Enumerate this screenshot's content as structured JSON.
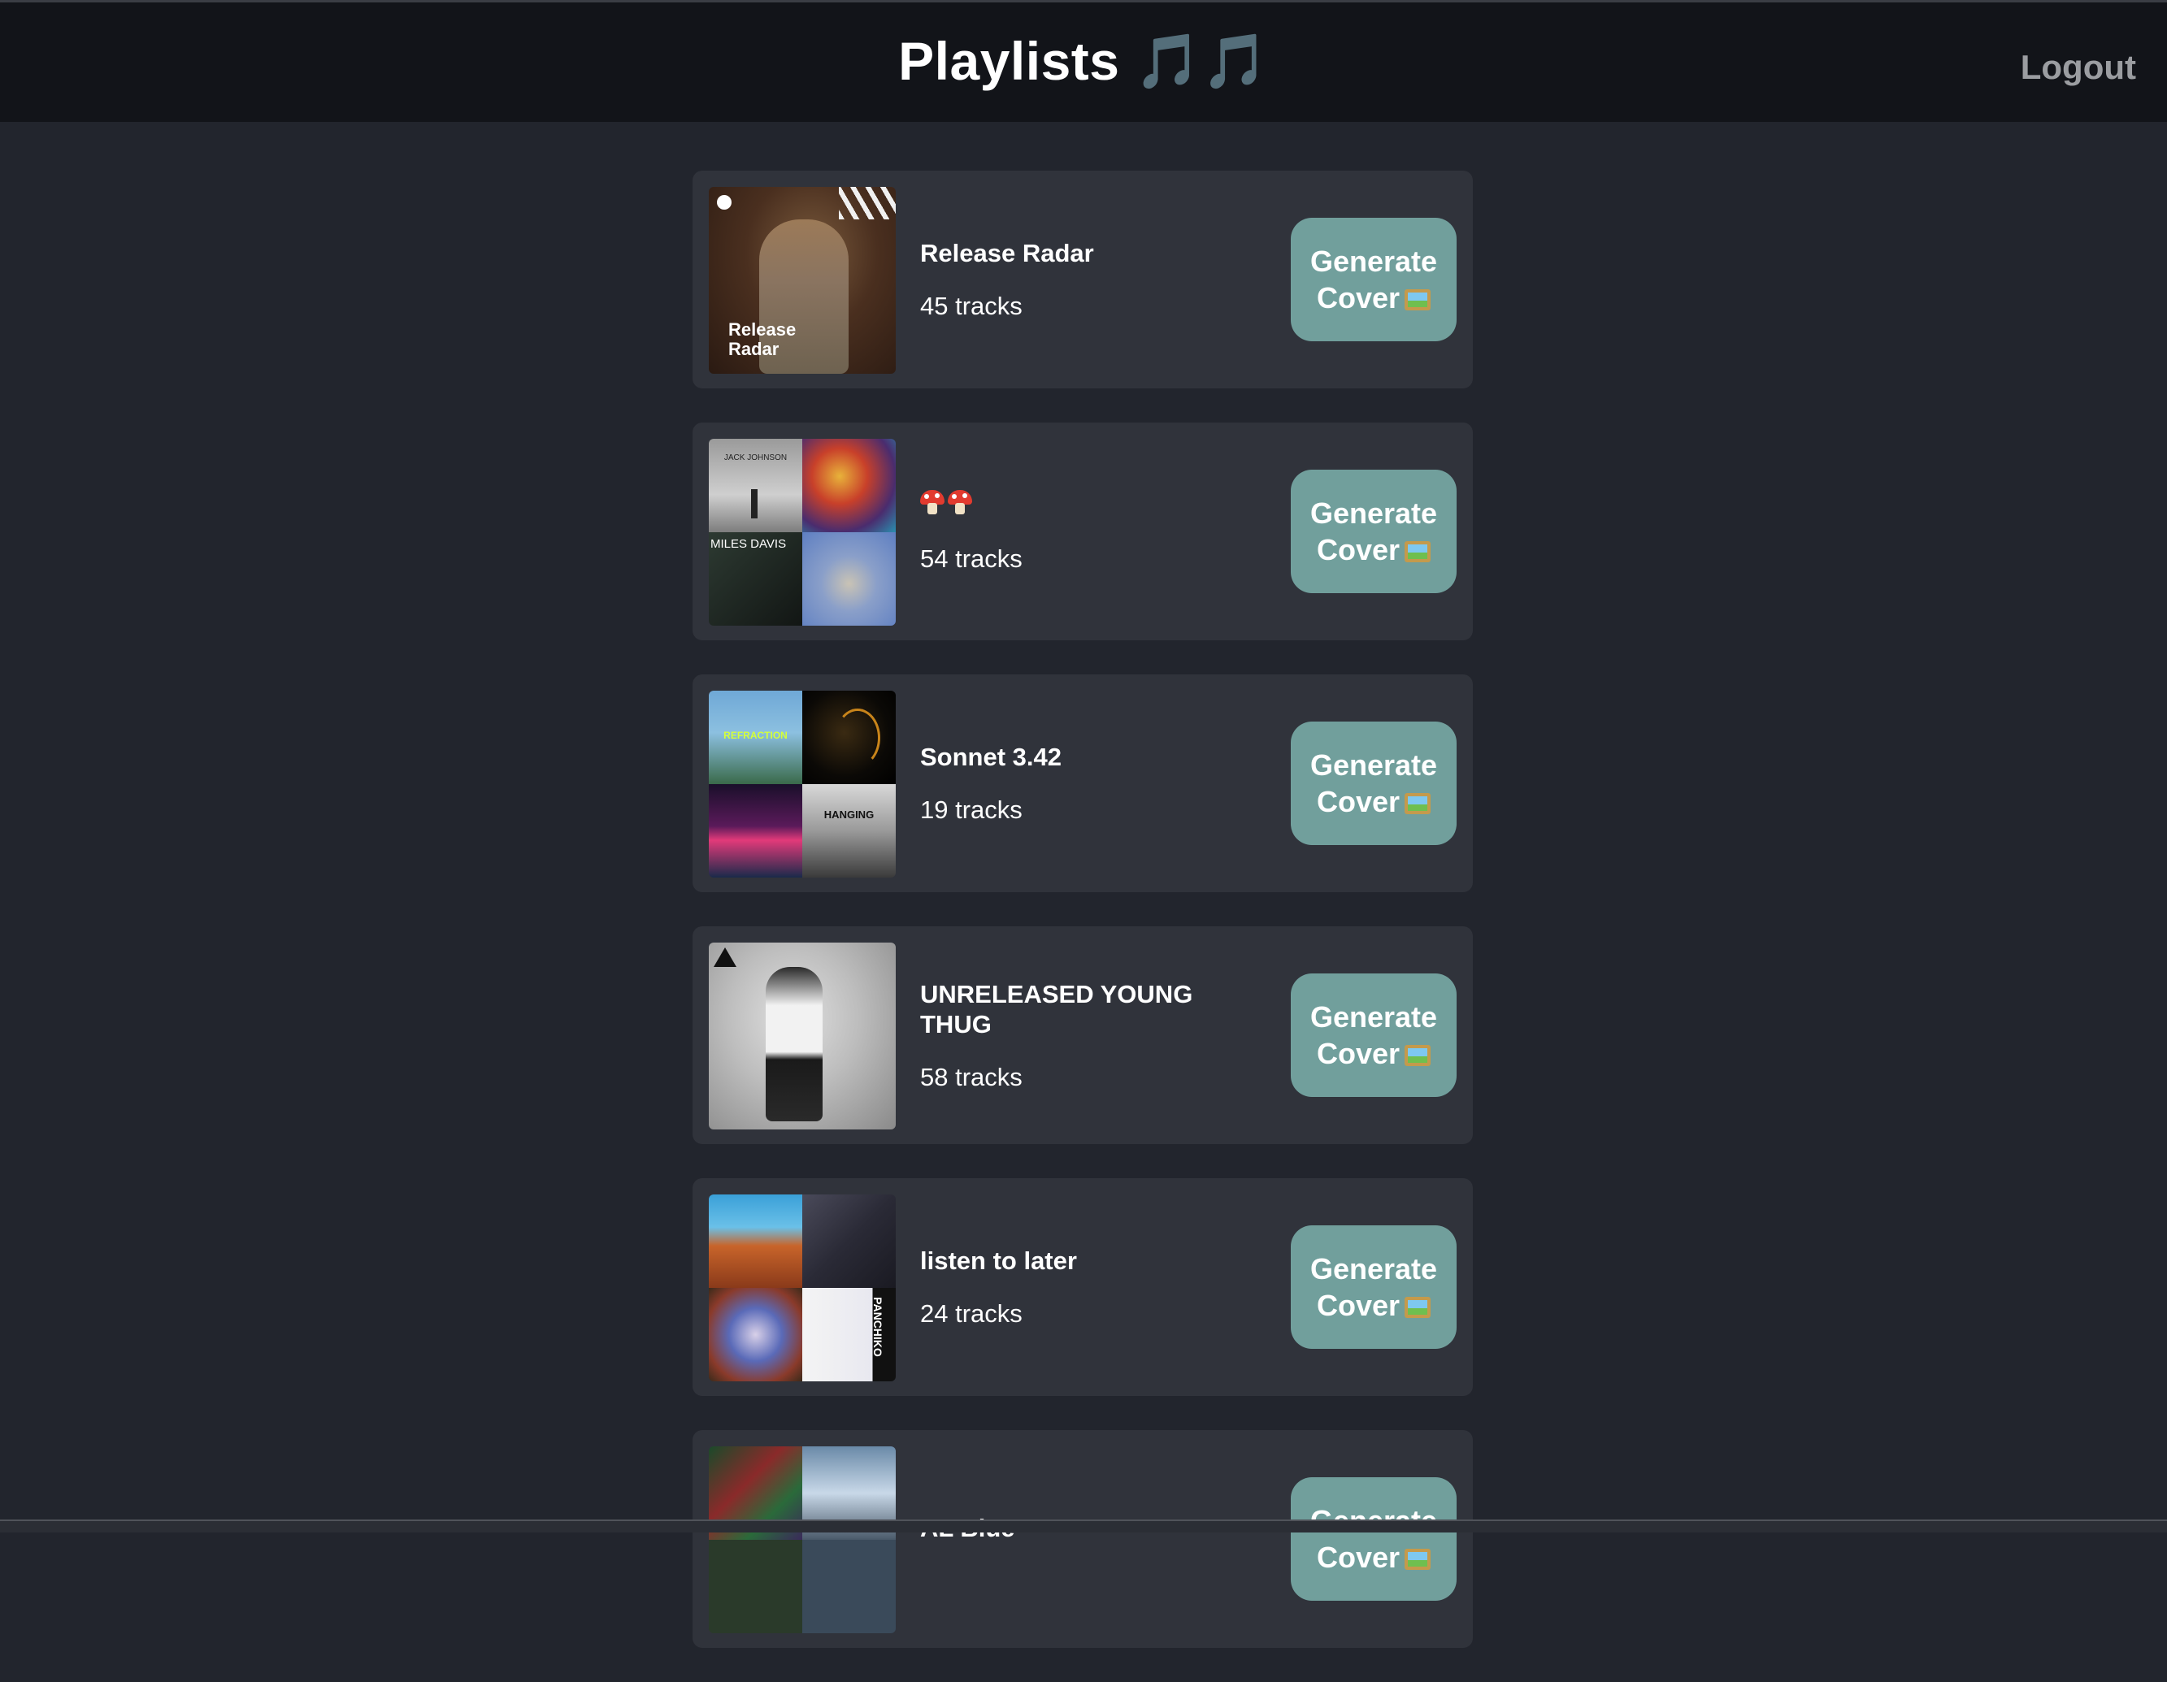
{
  "header": {
    "title": "Playlists",
    "title_suffix": "🎵🎵",
    "logout_label": "Logout"
  },
  "playlists": [
    {
      "name": "Release Radar",
      "tracks": "45 tracks",
      "cover_text": "Release\nRadar",
      "button_label": "Generate",
      "button_label_2": "Cover"
    },
    {
      "name": "🍄🍄",
      "tracks": "54 tracks",
      "cover_text": "JACK JOHNSON",
      "cover_text_2": "MILES DAVIS",
      "button_label": "Generate",
      "button_label_2": "Cover"
    },
    {
      "name": "Sonnet 3.42",
      "tracks": "19 tracks",
      "cover_text": "REFRACTION",
      "cover_text_2": "HANGING",
      "button_label": "Generate",
      "button_label_2": "Cover"
    },
    {
      "name": "UNRELEASED YOUNG THUG",
      "tracks": "58 tracks",
      "button_label": "Generate",
      "button_label_2": "Cover"
    },
    {
      "name": "listen to later",
      "tracks": "24 tracks",
      "cover_text": "PANCHIKO",
      "button_label": "Generate",
      "button_label_2": "Cover"
    },
    {
      "name": "AL Blue",
      "tracks": "",
      "button_label": "Generate",
      "button_label_2": "Cover"
    }
  ],
  "colors": {
    "background": "#22252d",
    "header": "#121419",
    "card": "#30333b",
    "button": "#719f9c"
  },
  "icons": {
    "button_icon": "framed-picture-icon",
    "music_note": "music-notes-icon",
    "mushroom": "mushroom-icon"
  }
}
